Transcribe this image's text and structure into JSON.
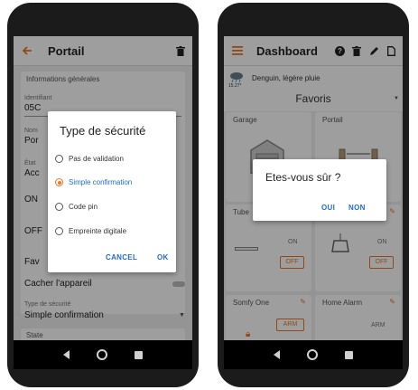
{
  "colors": {
    "accent": "#e8782b",
    "link": "#1e6ec8",
    "background": "#efefef"
  },
  "left_screen": {
    "header": {
      "back_icon": "arrow-left-icon",
      "title": "Portail",
      "delete_icon": "trash-icon"
    },
    "section_title": "Informations générales",
    "field_identifiant": {
      "label": "Identifiant",
      "value": "05C"
    },
    "field_nom": {
      "label": "Nom",
      "value": "Por"
    },
    "field_etat": {
      "label": "État",
      "value": "Acc"
    },
    "row_on": "ON",
    "row_off": "OFF",
    "row_favoris": "Fav",
    "cacher_label": "Cacher l'appareil",
    "securite": {
      "label": "Type de sécurité",
      "value": "Simple confirmation"
    },
    "state_label": "State",
    "dialog": {
      "title": "Type de sécurité",
      "options": [
        {
          "label": "Pas de validation",
          "selected": false
        },
        {
          "label": "Simple confirmation",
          "selected": true
        },
        {
          "label": "Code pin",
          "selected": false
        },
        {
          "label": "Empreinte digitale",
          "selected": false
        }
      ],
      "cancel": "CANCEL",
      "ok": "OK"
    }
  },
  "right_screen": {
    "header": {
      "menu_icon": "hamburger-icon",
      "title": "Dashboard",
      "icons": [
        "help-icon",
        "trash-icon",
        "pencil-icon",
        "file-icon"
      ]
    },
    "weather": {
      "icon": "cloud-rain-icon",
      "temp": "15.27°",
      "text": "Denguin, légère pluie"
    },
    "favoris": "Favoris",
    "tiles": [
      {
        "title": "Garage"
      },
      {
        "title": "Portail"
      },
      {
        "title": "Tube",
        "status": "ON",
        "button": "OFF"
      },
      {
        "title": "",
        "status": "ON",
        "button": "OFF"
      },
      {
        "title": "Somfy One",
        "button": "ARM"
      },
      {
        "title": "Home Alarm",
        "status": "ARM"
      }
    ],
    "dialog": {
      "title": "Etes-vous sûr ?",
      "yes": "OUI",
      "no": "NON"
    }
  }
}
